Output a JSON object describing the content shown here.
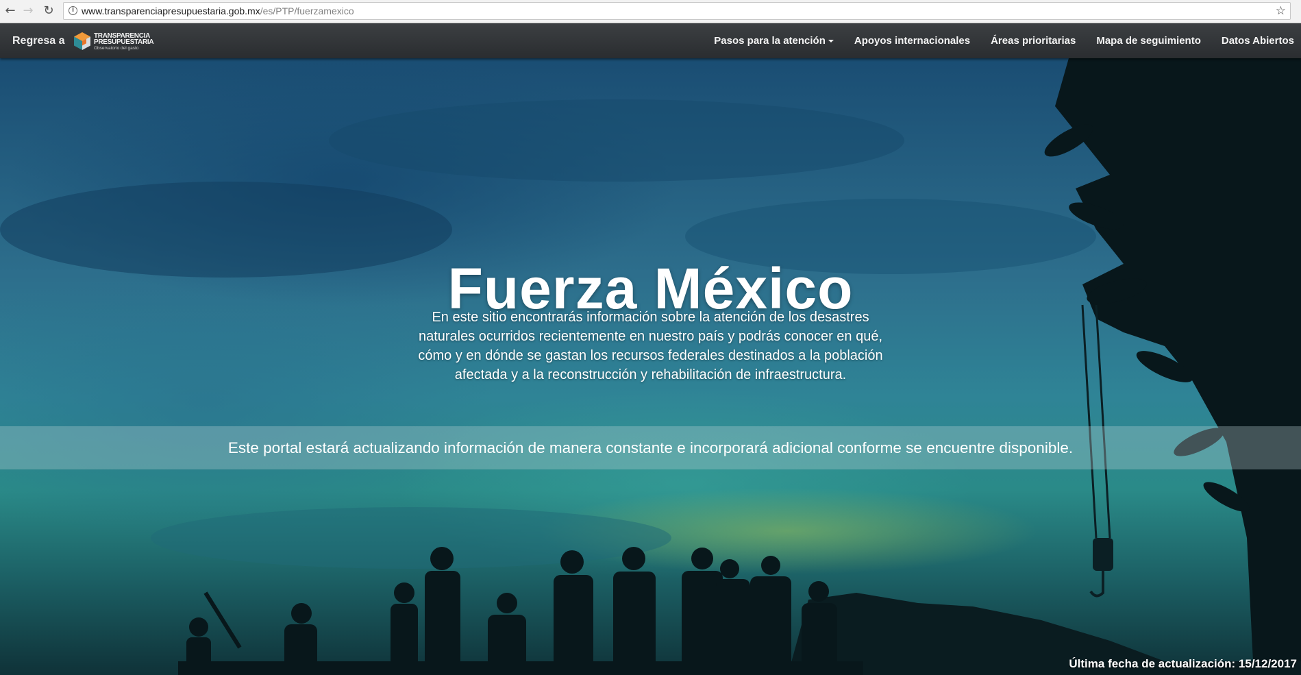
{
  "browser": {
    "url_host": "www.transparenciapresupuestaria.gob.mx",
    "url_path": "/es/PTP/fuerzamexico",
    "back_icon": "←",
    "forward_icon": "→",
    "reload_icon": "↻",
    "star_icon": "☆",
    "info_icon": "i"
  },
  "navbar": {
    "back_label": "Regresa a",
    "logo": {
      "line1": "TRANSPARENCIA",
      "line2": "PRESUPUESTARIA",
      "line3": "Observatorio del gasto"
    },
    "menu": [
      {
        "label": "Pasos para la atención",
        "has_dropdown": true
      },
      {
        "label": "Apoyos internacionales"
      },
      {
        "label": "Áreas prioritarias"
      },
      {
        "label": "Mapa de seguimiento"
      },
      {
        "label": "Datos Abiertos"
      }
    ]
  },
  "hero": {
    "title": "Fuerza México",
    "description": "En este sitio encontrarás información sobre la atención de los desastres naturales ocurridos recientemente en nuestro país y podrás conocer en qué, cómo y en dónde se gastan los recursos federales destinados a la población afectada y a la reconstrucción y rehabilitación de infraestructura.",
    "notice": "Este portal estará actualizando información de manera constante e incorporará adicional conforme se encuentre disponible.",
    "last_update": "Última fecha de actualización: 15/12/2017"
  },
  "colors": {
    "navbar_bg": "#2f3235",
    "logo_orange": "#e8752a",
    "logo_teal": "#2e8c96",
    "sky_blue": "#1a4d73",
    "silhouette": "#08171b"
  }
}
